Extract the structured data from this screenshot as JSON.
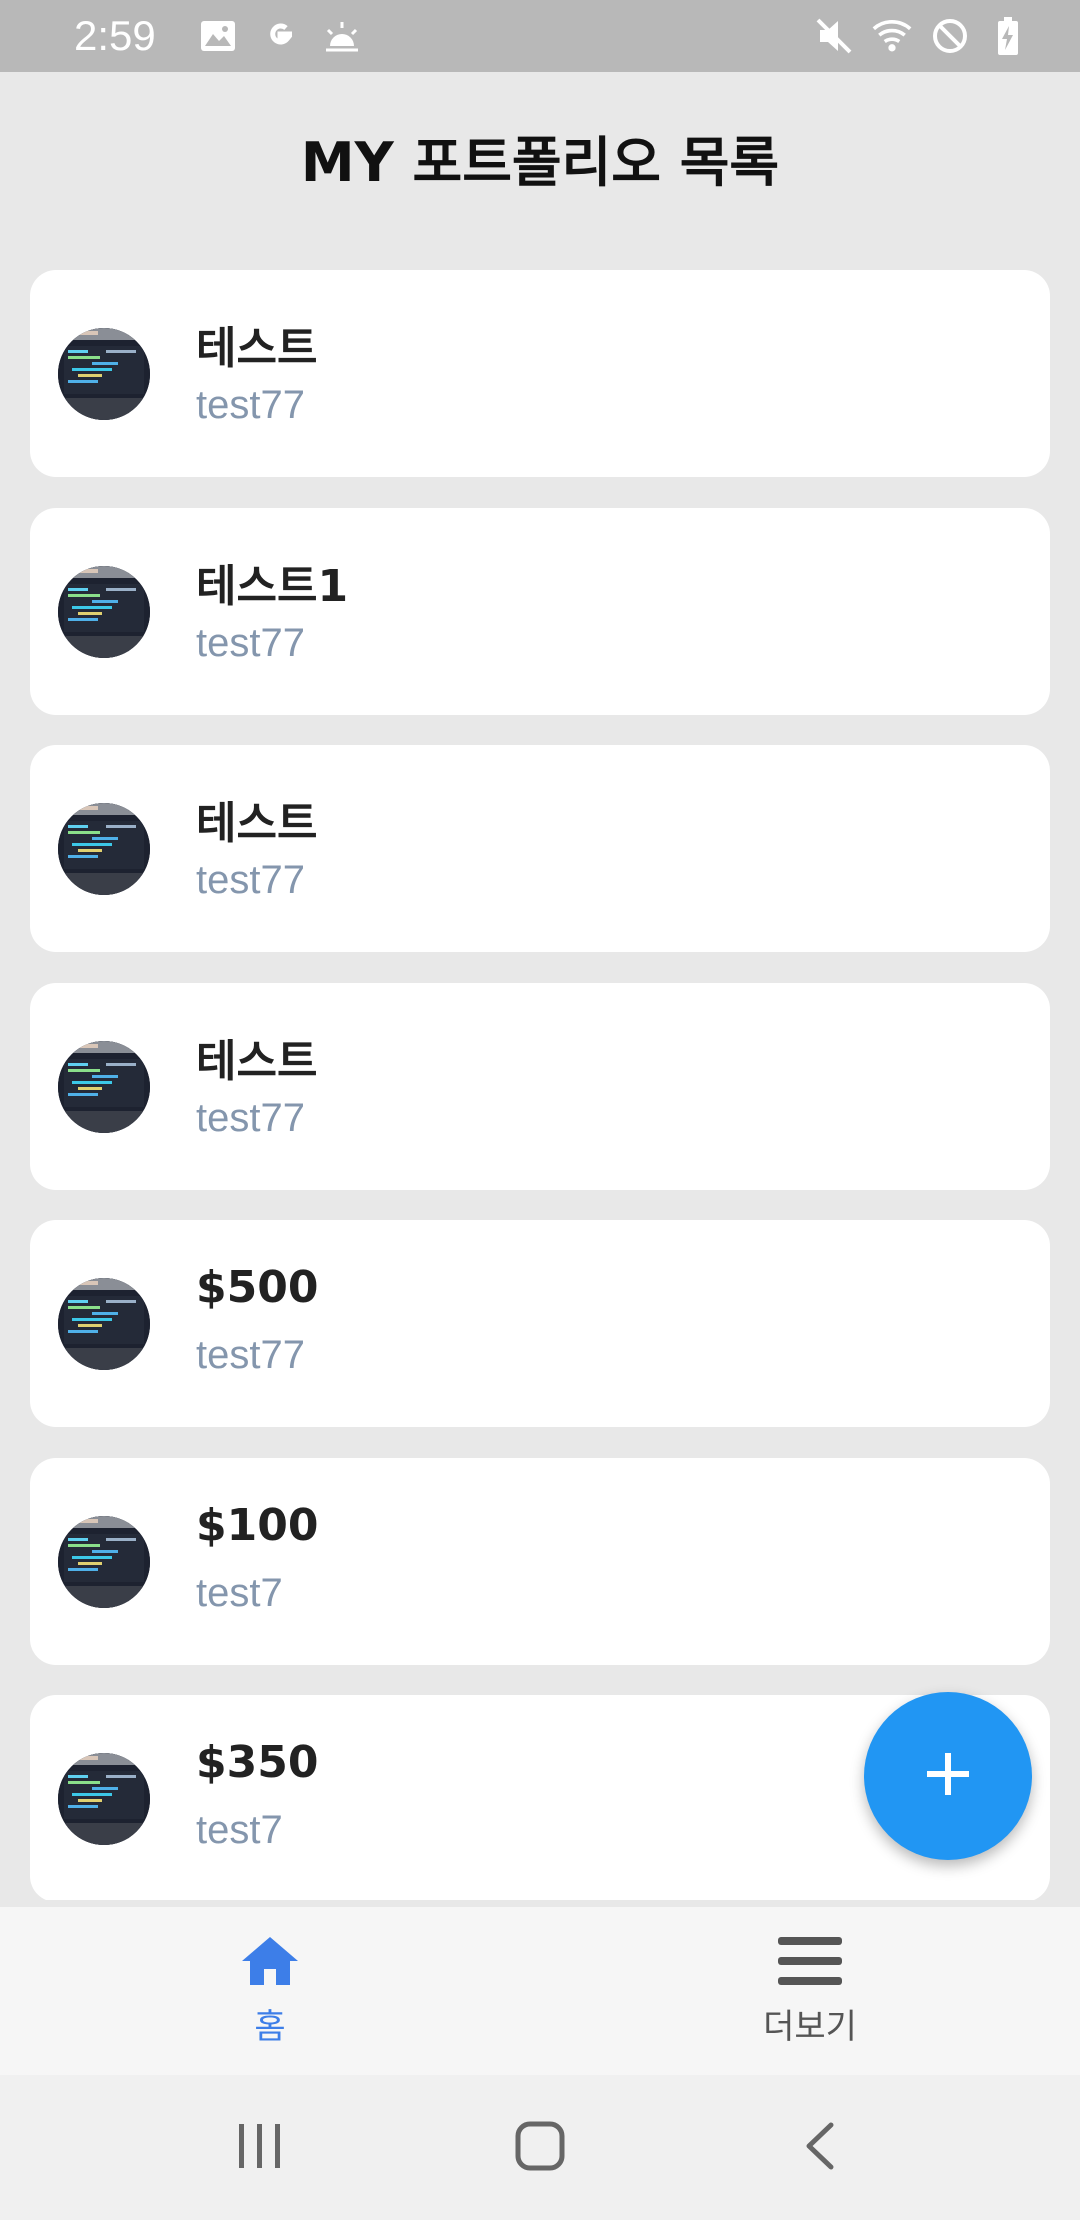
{
  "status_bar": {
    "time": "2:59",
    "left_icons": [
      "image-icon",
      "google-icon",
      "weather-icon"
    ],
    "right_icons": [
      "mute-icon",
      "wifi-icon",
      "dnd-icon",
      "battery-charging-icon"
    ]
  },
  "header": {
    "title": "MY 포트폴리오 목록"
  },
  "portfolios": [
    {
      "title": "테스트",
      "subtitle": "test77"
    },
    {
      "title": "테스트1",
      "subtitle": "test77"
    },
    {
      "title": "테스트",
      "subtitle": "test77"
    },
    {
      "title": "테스트",
      "subtitle": "test77"
    },
    {
      "title": "$500",
      "subtitle": "test77"
    },
    {
      "title": "$100",
      "subtitle": "test7"
    },
    {
      "title": "$350",
      "subtitle": "test7"
    }
  ],
  "fab": {
    "icon": "plus-icon"
  },
  "bottom_nav": {
    "items": [
      {
        "label": "홈",
        "icon": "home-icon",
        "active": true
      },
      {
        "label": "더보기",
        "icon": "menu-icon",
        "active": false
      }
    ]
  },
  "system_nav": {
    "icons": [
      "recent-apps-icon",
      "home-button-icon",
      "back-icon"
    ]
  },
  "colors": {
    "accent": "#2196f3",
    "active_tab": "#3d7ee8",
    "subtitle": "#8496ad",
    "background": "#e8e8e8",
    "status_bar": "#b8b8b8"
  }
}
